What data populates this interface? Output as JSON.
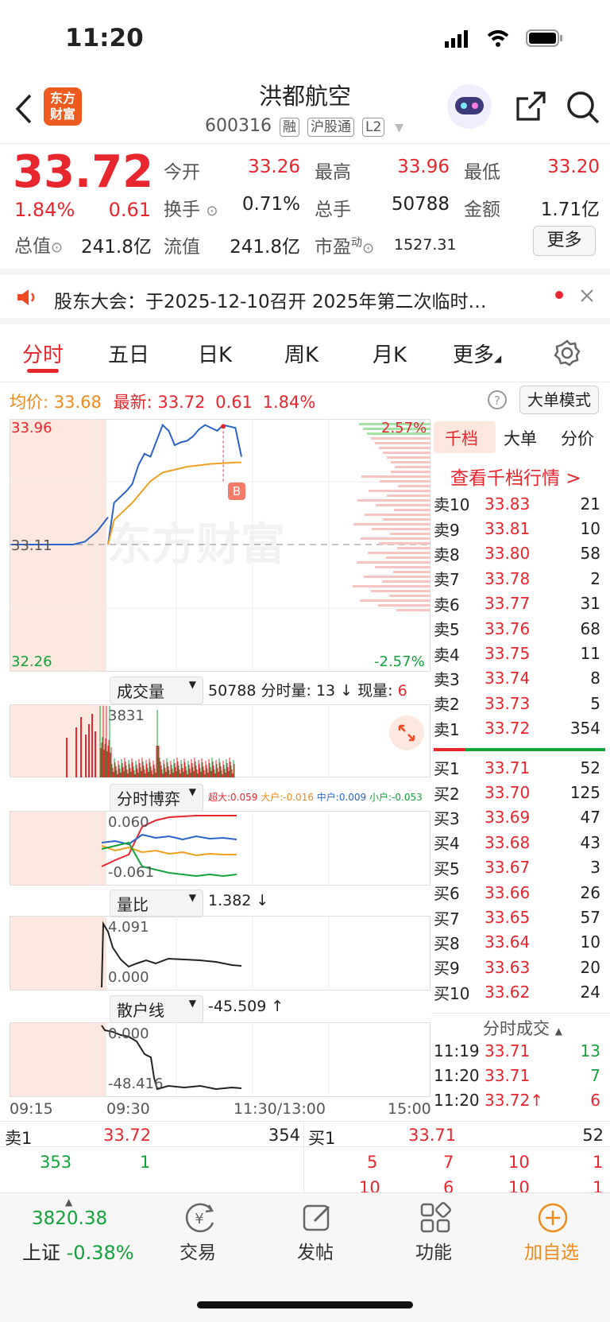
{
  "status": {
    "time": "11:20"
  },
  "header": {
    "logo_line1": "东方",
    "logo_line2": "财富",
    "name": "洪都航空",
    "code": "600316",
    "tags": [
      "融",
      "沪股通",
      "L2"
    ]
  },
  "quote": {
    "price": "33.72",
    "pct": "1.84%",
    "chg": "0.61",
    "open_label": "今开",
    "open": "33.26",
    "high_label": "最高",
    "high": "33.96",
    "low_label": "最低",
    "low": "33.20",
    "turnover_label": "换手",
    "turnover": "0.71%",
    "vol_label": "总手",
    "vol": "50788",
    "amount_label": "金额",
    "amount": "1.71亿",
    "mcap_label": "总值",
    "mcap": "241.8亿",
    "float_label": "流值",
    "float": "241.8亿",
    "pe_label": "市盈",
    "pe_sup": "动",
    "pe": "1527.31",
    "more": "更多"
  },
  "notice": {
    "text": "股东大会：于2025-12-10召开 2025年第二次临时…"
  },
  "tabs": [
    "分时",
    "五日",
    "日K",
    "周K",
    "月K",
    "更多"
  ],
  "chart_bar": {
    "avg_label": "均价:",
    "avg": "33.68",
    "last_label": "最新:",
    "last": "33.72",
    "chg": "0.61",
    "pct": "1.84%",
    "mode": "大单模式"
  },
  "chart": {
    "y_max": "33.96",
    "y_mid": "33.11",
    "y_min": "32.26",
    "pct_max": "2.57%",
    "pct_min": "-2.57%",
    "marker": "B",
    "watermark": "东方财富"
  },
  "chart_data": {
    "type": "line",
    "x": [
      "09:30",
      "09:35",
      "09:40",
      "09:45",
      "09:50",
      "09:55",
      "10:00",
      "10:05",
      "10:10",
      "10:15",
      "10:20",
      "10:25",
      "10:30",
      "10:35",
      "10:40",
      "10:45",
      "10:50",
      "10:55",
      "11:00",
      "11:05",
      "11:10",
      "11:15",
      "11:20"
    ],
    "series": [
      {
        "values": [
          33.11,
          33.4,
          33.44,
          33.48,
          33.53,
          33.66,
          33.74,
          33.72,
          33.83,
          33.94,
          33.9,
          33.8,
          33.82,
          33.83,
          33.86,
          33.91,
          33.94,
          33.92,
          33.9,
          33.94,
          33.93,
          33.92,
          33.72
        ]
      },
      {
        "values": [
          33.11,
          33.28,
          33.32,
          33.36,
          33.4,
          33.45,
          33.5,
          33.55,
          33.58,
          33.61,
          33.62,
          33.63,
          33.64,
          33.65,
          33.655,
          33.66,
          33.665,
          33.67,
          33.672,
          33.675,
          33.677,
          33.68,
          33.68
        ]
      }
    ],
    "ylim": [
      32.26,
      33.96
    ]
  },
  "vol_bar": {
    "label": "成交量",
    "total": "50788",
    "sub1": "分时量: 13 ↓",
    "sub2_label": "现量:",
    "sub2": "6",
    "max": "3831"
  },
  "game_bar": {
    "label": "分时博弈",
    "a": "超大:0.059",
    "b": "大户:-0.016",
    "c": "中户:0.009",
    "d": "小户:-0.053",
    "ymax": "0.060",
    "ymin": "-0.061"
  },
  "ratio_bar": {
    "label": "量比",
    "value": "1.382 ↓",
    "ymax": "4.091",
    "ymin": "0.000"
  },
  "retail_bar": {
    "label": "散户线",
    "value": "-45.509 ↑",
    "ymax": "0.000",
    "ymin": "-48.416"
  },
  "xaxis": [
    "09:15",
    "09:30",
    "11:30/13:00",
    "15:00"
  ],
  "right": {
    "tabs": [
      "千档",
      "大单",
      "分价"
    ],
    "link": "查看千档行情 >",
    "asks": [
      [
        "卖10",
        "33.83",
        "21"
      ],
      [
        "卖9",
        "33.81",
        "10"
      ],
      [
        "卖8",
        "33.80",
        "58"
      ],
      [
        "卖7",
        "33.78",
        "2"
      ],
      [
        "卖6",
        "33.77",
        "31"
      ],
      [
        "卖5",
        "33.76",
        "68"
      ],
      [
        "卖4",
        "33.75",
        "11"
      ],
      [
        "卖3",
        "33.74",
        "8"
      ],
      [
        "卖2",
        "33.73",
        "5"
      ],
      [
        "卖1",
        "33.72",
        "354"
      ]
    ],
    "bids": [
      [
        "买1",
        "33.71",
        "52"
      ],
      [
        "买2",
        "33.70",
        "125"
      ],
      [
        "买3",
        "33.69",
        "47"
      ],
      [
        "买4",
        "33.68",
        "43"
      ],
      [
        "买5",
        "33.67",
        "3"
      ],
      [
        "买6",
        "33.66",
        "26"
      ],
      [
        "买7",
        "33.65",
        "57"
      ],
      [
        "买8",
        "33.64",
        "10"
      ],
      [
        "买9",
        "33.63",
        "20"
      ],
      [
        "买10",
        "33.62",
        "24"
      ]
    ],
    "ticks_label": "分时成交",
    "ticks": [
      [
        "11:19",
        "33.71",
        "13"
      ],
      [
        "11:20",
        "33.71",
        "7"
      ],
      [
        "11:20",
        "33.72↑",
        "6"
      ]
    ]
  },
  "bottom_q": {
    "s_label": "卖1",
    "s_price": "33.72",
    "s_vol": "354",
    "b_label": "买1",
    "b_price": "33.71",
    "b_vol": "52",
    "r2a": "353",
    "r2b": "1",
    "r2c": "5",
    "r2d": "7",
    "r2e": "10",
    "r2f": "1",
    "r3a": "10",
    "r3b": "6",
    "r3c": "10",
    "r3d": "1"
  },
  "nav": {
    "index_val": "3820.38",
    "index_name": "上证",
    "index_pct": "-0.38%",
    "items": [
      "交易",
      "发帖",
      "功能",
      "加自选"
    ]
  }
}
